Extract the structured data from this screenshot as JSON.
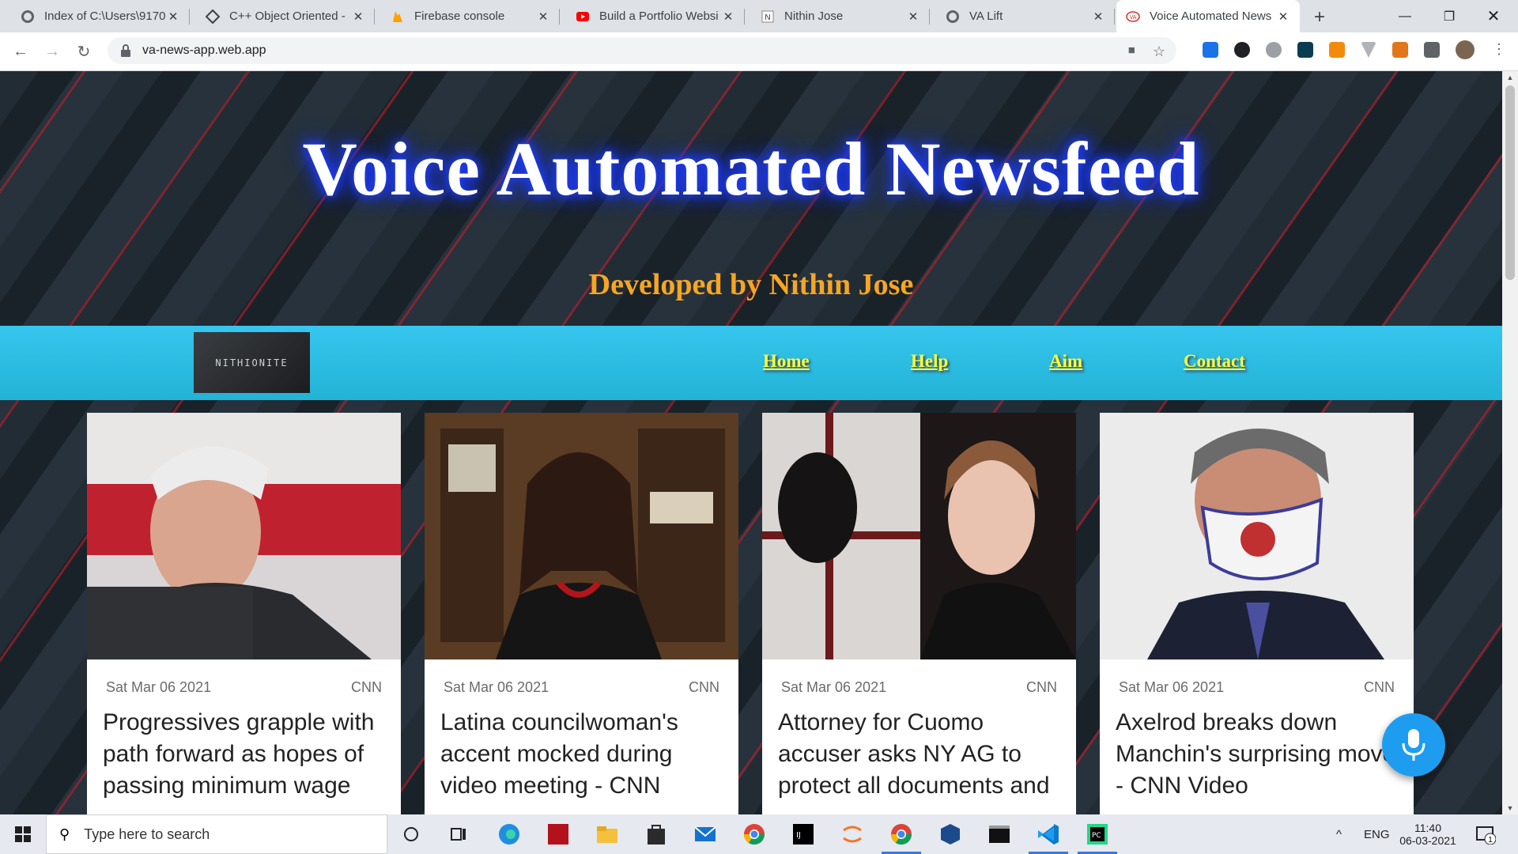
{
  "browser": {
    "tabs": [
      {
        "label": "Index of C:\\Users\\9170",
        "icon": "globe-icon"
      },
      {
        "label": "C++ Object Oriented -",
        "icon": "diamond-icon"
      },
      {
        "label": "Firebase console",
        "icon": "firebase-icon"
      },
      {
        "label": "Build a Portfolio Websi",
        "icon": "youtube-icon"
      },
      {
        "label": "Nithin Jose",
        "icon": "profile-icon"
      },
      {
        "label": "VA Lift",
        "icon": "globe-icon"
      },
      {
        "label": "Voice Automated News",
        "icon": "va-icon"
      }
    ],
    "url": "va-news-app.web.app"
  },
  "hero": {
    "title": "Voice Automated Newsfeed",
    "subtitle": "Developed by Nithin Jose"
  },
  "nav": {
    "logo_text": "NITHIONITE",
    "links": [
      "Home",
      "Help",
      "Aim",
      "Contact"
    ]
  },
  "cards": [
    {
      "date": "Sat Mar 06 2021",
      "source": "CNN",
      "headline": "Progressives grapple with path forward as hopes of passing minimum wage"
    },
    {
      "date": "Sat Mar 06 2021",
      "source": "CNN",
      "headline": "Latina councilwoman's accent mocked during video meeting - CNN"
    },
    {
      "date": "Sat Mar 06 2021",
      "source": "CNN",
      "headline": "Attorney for Cuomo accuser asks NY AG to protect all documents and"
    },
    {
      "date": "Sat Mar 06 2021",
      "source": "CNN",
      "headline": "Axelrod breaks down Manchin's surprising move - CNN Video"
    }
  ],
  "taskbar": {
    "search_placeholder": "Type here to search",
    "language": "ENG",
    "time": "11:40",
    "date": "06-03-2021",
    "notification_count": "1"
  }
}
